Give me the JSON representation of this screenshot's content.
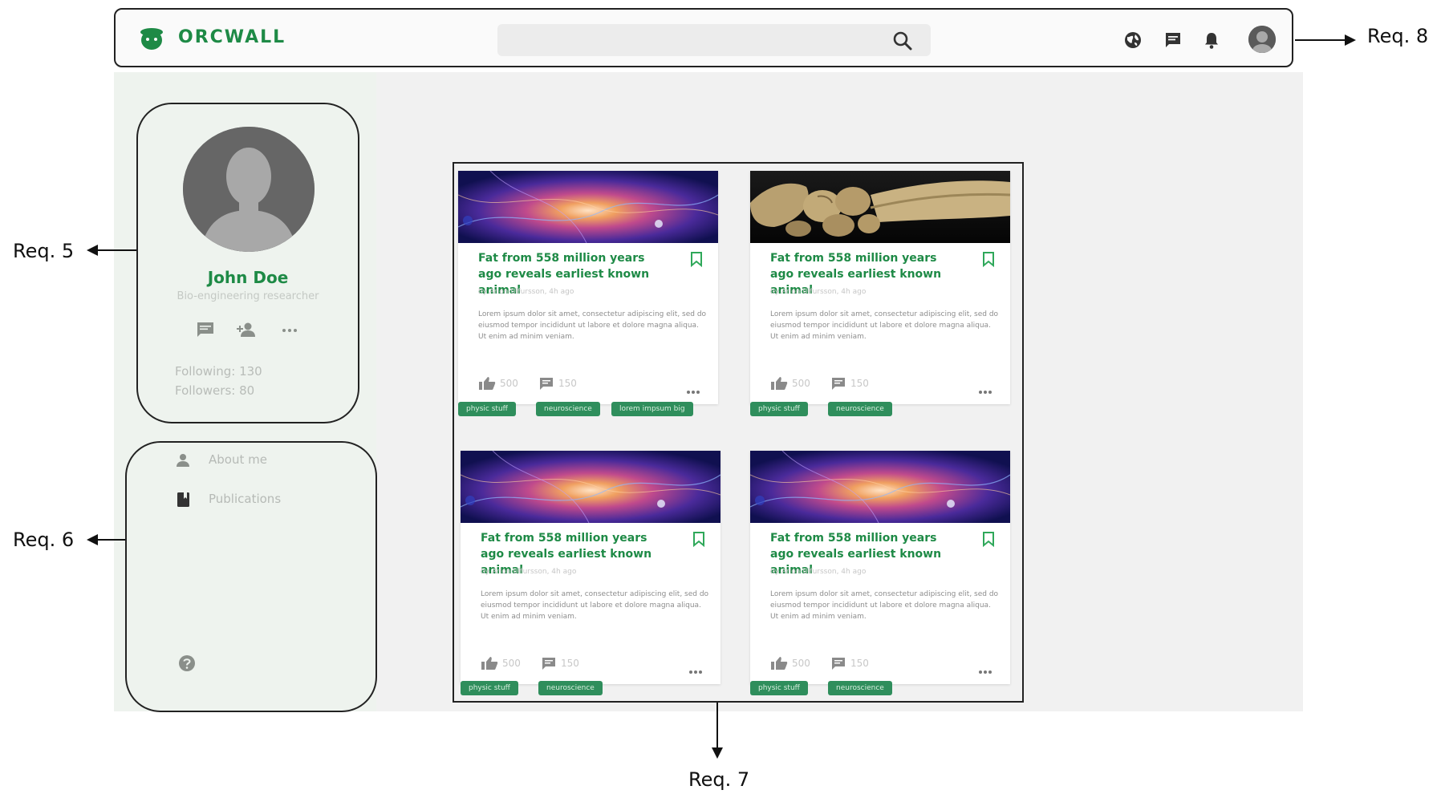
{
  "header": {
    "brand": "ORCWALL",
    "search": {
      "value": "",
      "placeholder": ""
    },
    "icons": [
      "globe-icon",
      "messages-icon",
      "notifications-icon",
      "avatar"
    ]
  },
  "profile": {
    "name": "John Doe",
    "role": "Bio-engineering researcher",
    "actions": [
      "message-icon",
      "add-friend-icon",
      "more-icon"
    ],
    "following": "Following: 130",
    "followers": "Followers: 80"
  },
  "menu": {
    "items": [
      {
        "label": "About me",
        "icon": "person-icon"
      },
      {
        "label": "Publications",
        "icon": "book-icon"
      }
    ],
    "help_icon": "help-icon"
  },
  "posts": [
    {
      "title": "Fat from 558 million years ago reveals earliest known animal",
      "byline": "by Arion Ulfursson, 4h ago",
      "excerpt": "Lorem ipsum dolor sit amet, consectetur adipiscing elit, sed do eiusmod tempor incididunt ut labore et dolore magna aliqua. Ut enim ad minim veniam.",
      "likes": "500",
      "comments": "150",
      "image": "nebula",
      "tags": [
        "physic stuff",
        "neuroscience",
        "lorem impsum big"
      ]
    },
    {
      "title": "Fat from 558 million years ago reveals earliest known animal",
      "byline": "by Arion Ulfursson, 4h ago",
      "excerpt": "Lorem ipsum dolor sit amet, consectetur adipiscing elit, sed do eiusmod tempor incididunt ut labore et dolore magna aliqua. Ut enim ad minim veniam.",
      "likes": "500",
      "comments": "150",
      "image": "bones",
      "tags": [
        "physic stuff",
        "neuroscience"
      ]
    },
    {
      "title": "Fat from 558 million years ago reveals earliest known animal",
      "byline": "by Arion Ulfursson, 4h ago",
      "excerpt": "Lorem ipsum dolor sit amet, consectetur adipiscing elit, sed do eiusmod tempor incididunt ut labore et dolore magna aliqua. Ut enim ad minim veniam.",
      "likes": "500",
      "comments": "150",
      "image": "nebula",
      "tags": [
        "physic stuff",
        "neuroscience"
      ]
    },
    {
      "title": "Fat from 558 million years ago reveals earliest known animal",
      "byline": "by Arion Ulfursson, 4h ago",
      "excerpt": "Lorem ipsum dolor sit amet, consectetur adipiscing elit, sed do eiusmod tempor incididunt ut labore et dolore magna aliqua. Ut enim ad minim veniam.",
      "likes": "500",
      "comments": "150",
      "image": "nebula",
      "tags": [
        "physic stuff",
        "neuroscience"
      ]
    }
  ],
  "annotations": {
    "req5": "Req. 5",
    "req6": "Req. 6",
    "req7": "Req. 7",
    "req8": "Req. 8"
  },
  "colors": {
    "brand_green": "#1e8a46",
    "tag_green": "#2f8e5c",
    "panel_bg": "#eef3ee",
    "page_bg": "#f1f1f1"
  }
}
